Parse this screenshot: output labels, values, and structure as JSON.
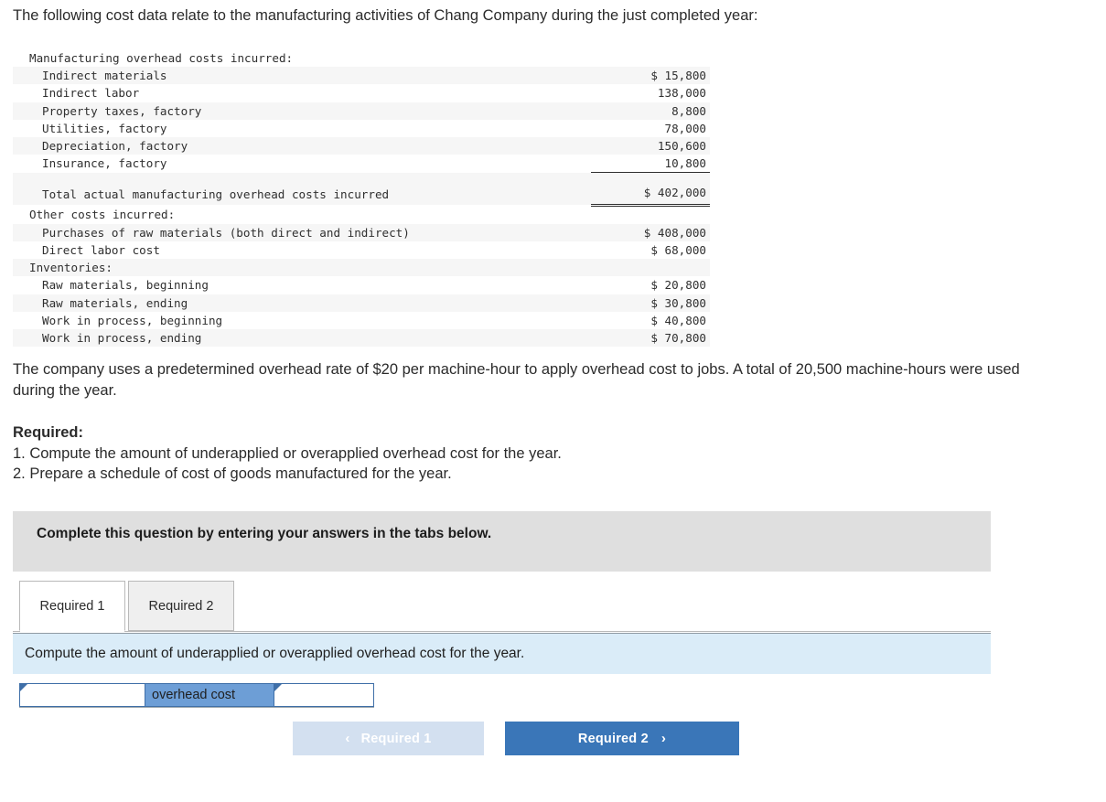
{
  "intro": "The following cost data relate to the manufacturing activities of Chang Company during the just completed year:",
  "cost_table": {
    "rows": [
      {
        "label": "Manufacturing overhead costs incurred:",
        "amount": "",
        "indent": 0,
        "stripe": false,
        "rule": "none"
      },
      {
        "label": "Indirect materials",
        "amount": "$ 15,800",
        "indent": 1,
        "stripe": true,
        "rule": "none"
      },
      {
        "label": "Indirect labor",
        "amount": "138,000",
        "indent": 1,
        "stripe": false,
        "rule": "none"
      },
      {
        "label": "Property taxes, factory",
        "amount": "8,800",
        "indent": 1,
        "stripe": true,
        "rule": "none"
      },
      {
        "label": "Utilities, factory",
        "amount": "78,000",
        "indent": 1,
        "stripe": false,
        "rule": "none"
      },
      {
        "label": "Depreciation, factory",
        "amount": "150,600",
        "indent": 1,
        "stripe": true,
        "rule": "none"
      },
      {
        "label": "Insurance, factory",
        "amount": "10,800",
        "indent": 1,
        "stripe": false,
        "rule": "none"
      },
      {
        "label": "Total actual manufacturing overhead costs incurred",
        "amount": "$ 402,000",
        "indent": 1,
        "stripe": true,
        "rule": "total"
      },
      {
        "label": "Other costs incurred:",
        "amount": "",
        "indent": 0,
        "stripe": false,
        "rule": "none"
      },
      {
        "label": "Purchases of raw materials (both direct and indirect)",
        "amount": "$ 408,000",
        "indent": 1,
        "stripe": true,
        "rule": "none"
      },
      {
        "label": "Direct labor cost",
        "amount": "$ 68,000",
        "indent": 1,
        "stripe": false,
        "rule": "none"
      },
      {
        "label": "Inventories:",
        "amount": "",
        "indent": 0,
        "stripe": true,
        "rule": "none"
      },
      {
        "label": "Raw materials, beginning",
        "amount": "$ 20,800",
        "indent": 1,
        "stripe": false,
        "rule": "none"
      },
      {
        "label": "Raw materials, ending",
        "amount": "$ 30,800",
        "indent": 1,
        "stripe": true,
        "rule": "none"
      },
      {
        "label": "Work in process, beginning",
        "amount": "$ 40,800",
        "indent": 1,
        "stripe": false,
        "rule": "none"
      },
      {
        "label": "Work in process, ending",
        "amount": "$ 70,800",
        "indent": 1,
        "stripe": true,
        "rule": "none"
      }
    ]
  },
  "rate_paragraph": "The company uses a predetermined overhead rate of $20 per machine-hour to apply overhead cost to jobs. A total of 20,500 machine-hours were used during the year.",
  "required": {
    "heading": "Required:",
    "item_1": "1. Compute the amount of underapplied or overapplied overhead cost for the year.",
    "item_2": "2. Prepare a schedule of cost of goods manufactured for the year."
  },
  "banner": {
    "text": "Complete this question by entering your answers in the tabs below."
  },
  "tabs": [
    {
      "label": "Required 1",
      "active": true
    },
    {
      "label": "Required 2",
      "active": false
    }
  ],
  "instruction": "Compute the amount of underapplied or overapplied overhead cost for the year.",
  "answer_row": {
    "value_left": "",
    "middle_label": "overhead cost",
    "value_right": ""
  },
  "nav": {
    "prev_label": "Required 1",
    "prev_chevron": "‹",
    "next_label": "Required 2",
    "next_chevron": "›",
    "prev_color": "#d3e0f0",
    "next_color": "#3a76b8"
  }
}
